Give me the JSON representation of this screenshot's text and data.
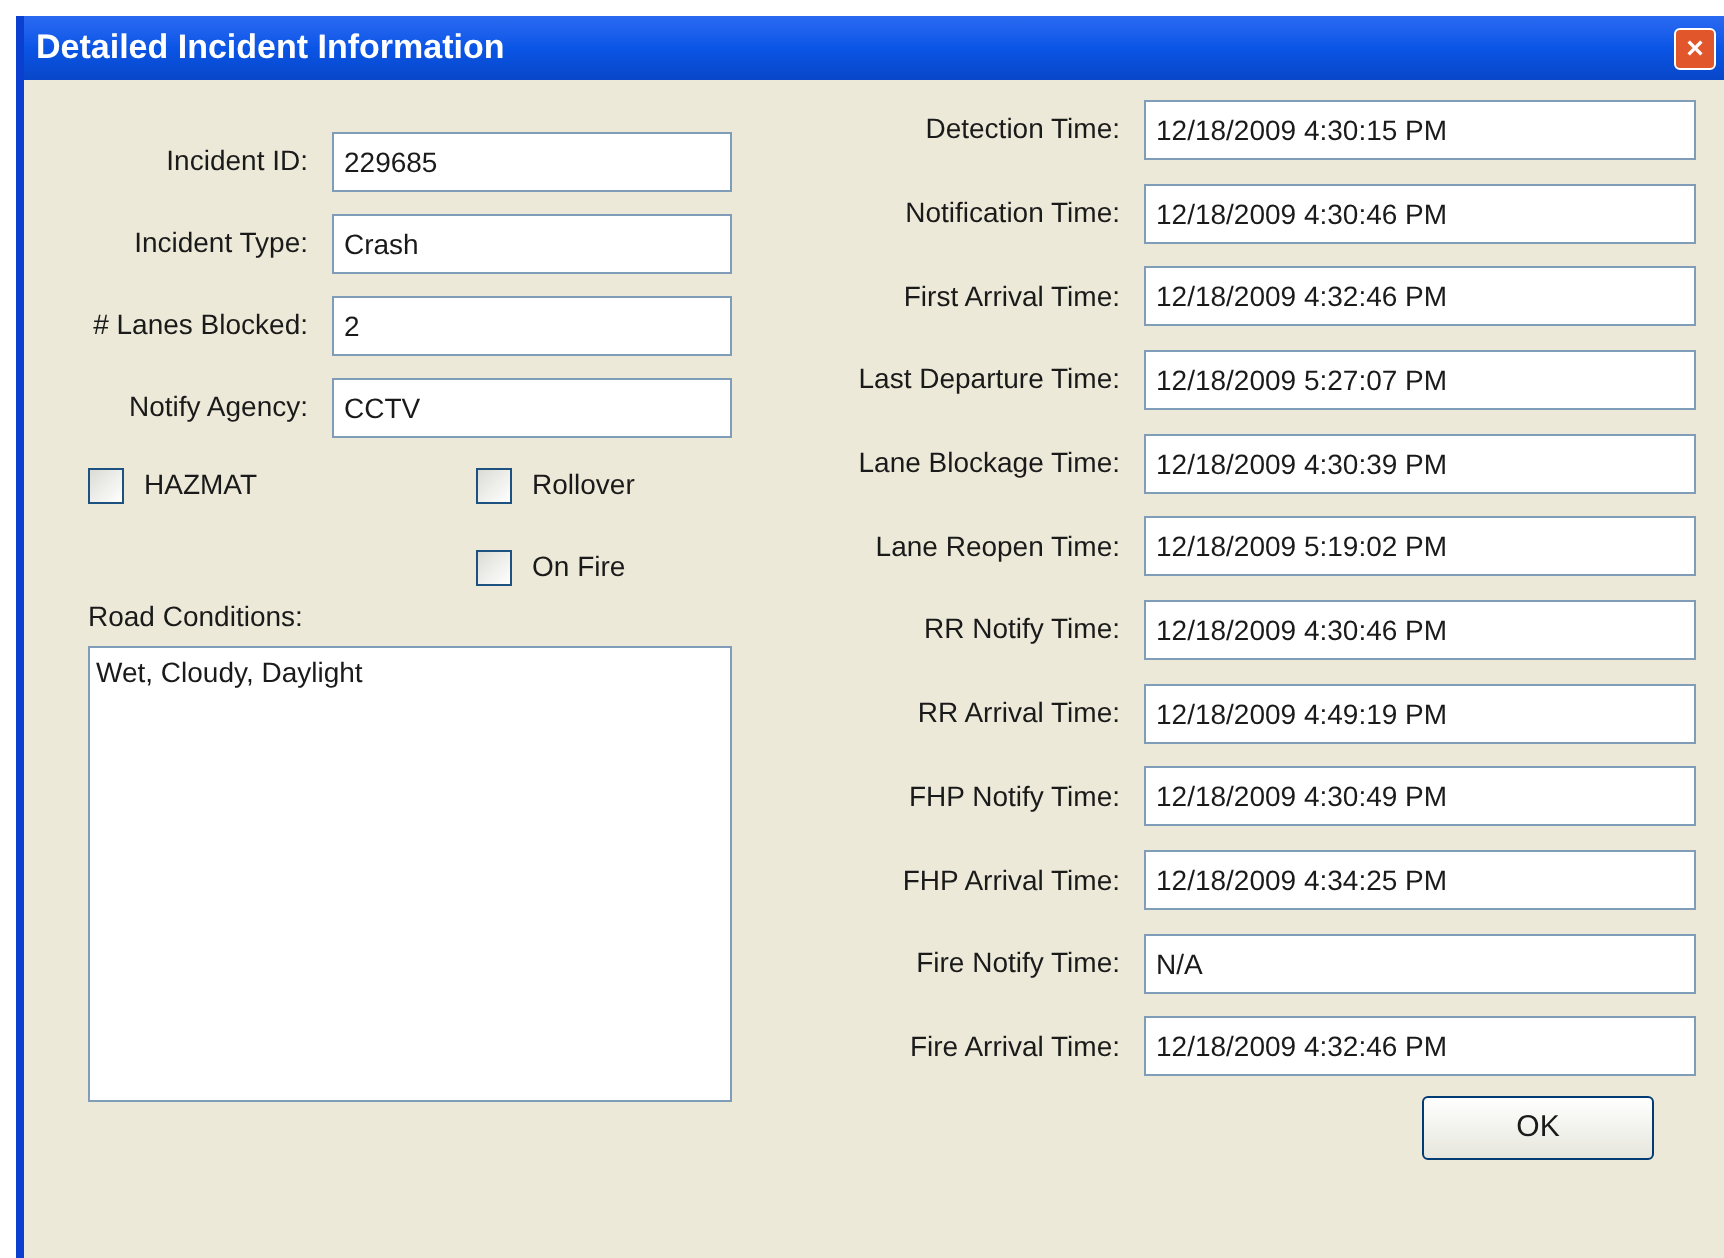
{
  "window": {
    "title": "Detailed Incident Information",
    "close": "×"
  },
  "left_fields": [
    {
      "label": "Incident ID:",
      "value": "229685"
    },
    {
      "label": "Incident Type:",
      "value": "Crash"
    },
    {
      "label": "# Lanes Blocked:",
      "value": "2"
    },
    {
      "label": "Notify Agency:",
      "value": "CCTV"
    }
  ],
  "checkboxes": [
    {
      "label": "HAZMAT",
      "checked": false
    },
    {
      "label": "Rollover",
      "checked": false
    },
    {
      "label": "On Fire",
      "checked": false
    }
  ],
  "road_conditions": {
    "label": "Road Conditions:",
    "value": "Wet, Cloudy, Daylight"
  },
  "time_fields": [
    {
      "label": "Detection Time:",
      "value": "12/18/2009 4:30:15 PM"
    },
    {
      "label": "Notification Time:",
      "value": "12/18/2009 4:30:46 PM"
    },
    {
      "label": "First Arrival Time:",
      "value": "12/18/2009 4:32:46 PM"
    },
    {
      "label": "Last Departure Time:",
      "value": "12/18/2009 5:27:07 PM"
    },
    {
      "label": "Lane Blockage Time:",
      "value": "12/18/2009 4:30:39 PM"
    },
    {
      "label": "Lane Reopen Time:",
      "value": "12/18/2009 5:19:02 PM"
    },
    {
      "label": "RR Notify Time:",
      "value": "12/18/2009 4:30:46 PM"
    },
    {
      "label": "RR Arrival Time:",
      "value": "12/18/2009 4:49:19 PM"
    },
    {
      "label": "FHP Notify Time:",
      "value": "12/18/2009 4:30:49 PM"
    },
    {
      "label": "FHP Arrival Time:",
      "value": "12/18/2009 4:34:25 PM"
    },
    {
      "label": "Fire Notify Time:",
      "value": "N/A"
    },
    {
      "label": "Fire Arrival Time:",
      "value": "12/18/2009 4:32:46 PM"
    }
  ],
  "ok_button": "OK"
}
